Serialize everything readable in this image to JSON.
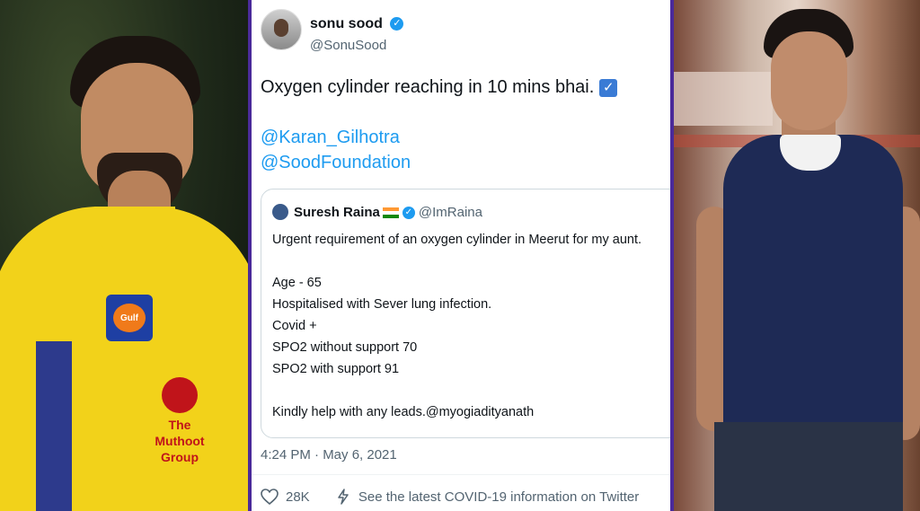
{
  "tweet": {
    "author": {
      "name": "sonu sood",
      "handle": "@SonuSood"
    },
    "text": "Oxygen cylinder reaching in 10 mins bhai.",
    "mentions": [
      "@Karan_Gilhotra",
      "@SoodFoundation"
    ],
    "quote": {
      "name": "Suresh Raina",
      "handle": "@ImRaina",
      "lines": [
        "Urgent requirement of an oxygen cylinder in Meerut for my aunt.",
        "Age - 65",
        "Hospitalised with Sever lung infection.",
        "Covid +",
        "SPO2 without support 70",
        "SPO2 with support 91",
        "Kindly help with any leads.@myogiadityanath"
      ]
    },
    "timestamp": "4:24 PM · May 6, 2021",
    "likes": "28K",
    "covid_info": "See the latest COVID-19 information on Twitter"
  },
  "left_photo": {
    "gulf_logo": "Gulf",
    "sponsor": [
      "The",
      "Muthoot",
      "Group"
    ]
  },
  "icons": {
    "verified": "verified-badge-icon",
    "check": "check-mark-emoji-icon",
    "flag": "india-flag-icon",
    "heart": "heart-icon",
    "bolt": "bolt-icon"
  },
  "colors": {
    "link": "#1d9bf0",
    "text": "#0f1419",
    "secondary": "#536471",
    "panel_border": "#4a2a9a"
  }
}
